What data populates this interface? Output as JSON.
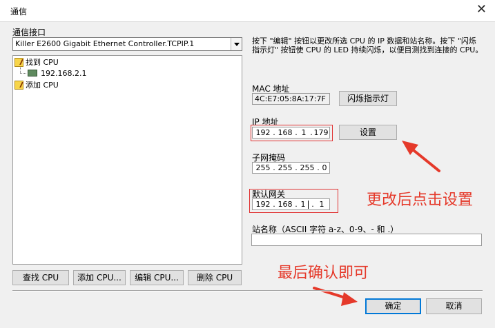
{
  "window": {
    "title": "通信",
    "close_glyph": "✕"
  },
  "interface": {
    "label": "通信接口",
    "selected": "Killer E2600 Gigabit Ethernet Controller.TCPIP.1"
  },
  "tree": {
    "found_cpu": "找到 CPU",
    "found_ip": "192.168.2.1",
    "add_cpu": "添加 CPU"
  },
  "left_buttons": {
    "find": "查找 CPU",
    "add": "添加 CPU...",
    "edit": "编辑 CPU...",
    "delete": "删除 CPU"
  },
  "description": "按下 \"编辑\" 按钮以更改所选 CPU 的 IP 数据和站名称。按下 \"闪烁指示灯\" 按钮使 CPU 的 LED 持续闪烁，以便目测找到连接的 CPU。",
  "mac": {
    "label": "MAC 地址",
    "value": "4C:E7:05:8A:17:7F",
    "blink_button": "闪烁指示灯"
  },
  "ip": {
    "label": "IP 地址",
    "octets": [
      "192",
      "168",
      "1",
      "179"
    ],
    "set_button": "设置"
  },
  "subnet": {
    "label": "子网掩码",
    "octets": [
      "255",
      "255",
      "255",
      "0"
    ]
  },
  "gateway": {
    "label": "默认网关",
    "octets": [
      "192",
      "168",
      "1",
      "1"
    ]
  },
  "station": {
    "label": "站名称（ASCII 字符 a-z、0-9、- 和 .）",
    "value": ""
  },
  "footer": {
    "ok": "确定",
    "cancel": "取消"
  },
  "annotations": {
    "change_then_set": "更改后点击设置",
    "finally_confirm": "最后确认即可"
  },
  "colors": {
    "annotation_red": "#e5392a",
    "focus_blue": "#0078d7"
  }
}
